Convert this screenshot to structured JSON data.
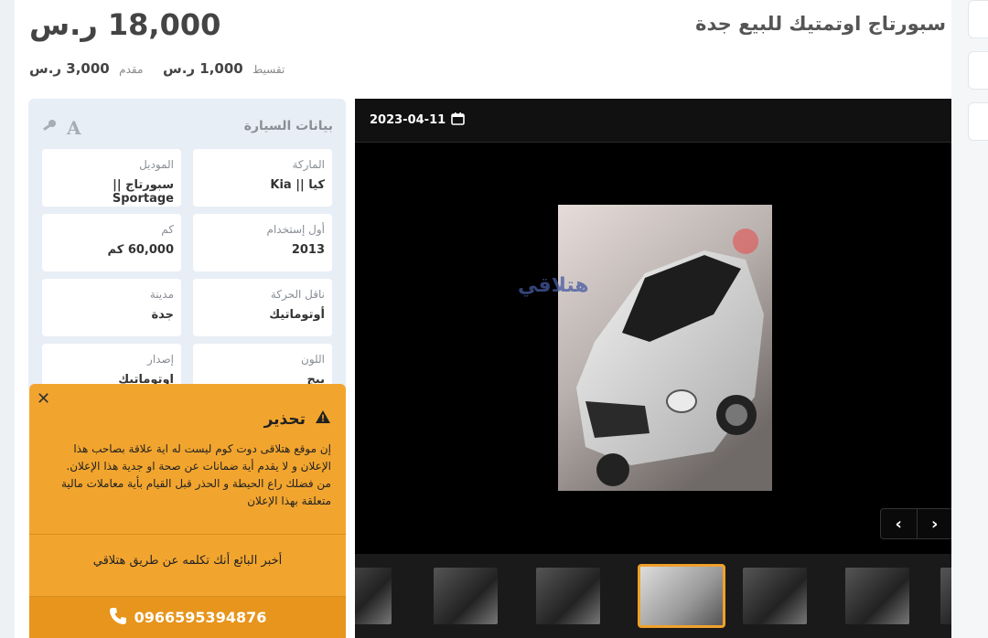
{
  "listing": {
    "title": "سبورتاج اوتمتيك للبيع جدة",
    "price": "18,000 ر.س",
    "installment_label": "تقسيط",
    "installment_value": "1,000 ر.س",
    "down_label": "مقدم",
    "down_value": "3,000 ر.س"
  },
  "car_panel": {
    "title": "بيانات السيارة",
    "fields": [
      {
        "label": "الماركة",
        "value": "كيا || Kia"
      },
      {
        "label": "الموديل",
        "value": "سبورتاج || Sportage"
      },
      {
        "label": "أول إستخدام",
        "value": "2013"
      },
      {
        "label": "كم",
        "value": "60,000 كم"
      },
      {
        "label": "ناقل الحركة",
        "value": "أوتوماتيك"
      },
      {
        "label": "مدينة",
        "value": "جدة"
      },
      {
        "label": "اللون",
        "value": "بيج"
      },
      {
        "label": "إصدار",
        "value": "اوتوماتيك"
      }
    ]
  },
  "gallery": {
    "date": "2023-04-11",
    "watermark": "هتلاقي",
    "icons": {
      "calendar": "calendar-icon",
      "prev": "chevron-left-icon",
      "next": "chevron-right-icon"
    },
    "thumb_count": 7,
    "active_thumb": 3
  },
  "warning": {
    "title": "تحذير",
    "body": "إن موقع هتلاقى دوت كوم ليست له اية علاقة بصاحب هذا الإعلان و لا يقدم أية ضمانات عن صحة او جدية هذا الإعلان. من فضلك راع الحيطة و الحذر قبل القيام بأية معاملات مالية متعلقة بهذا الإعلان",
    "tell_seller": "أخبر البائع أنك تكلمه عن طريق هتلاقي",
    "phone": "0966595394876",
    "accent": "#f2a52e"
  }
}
